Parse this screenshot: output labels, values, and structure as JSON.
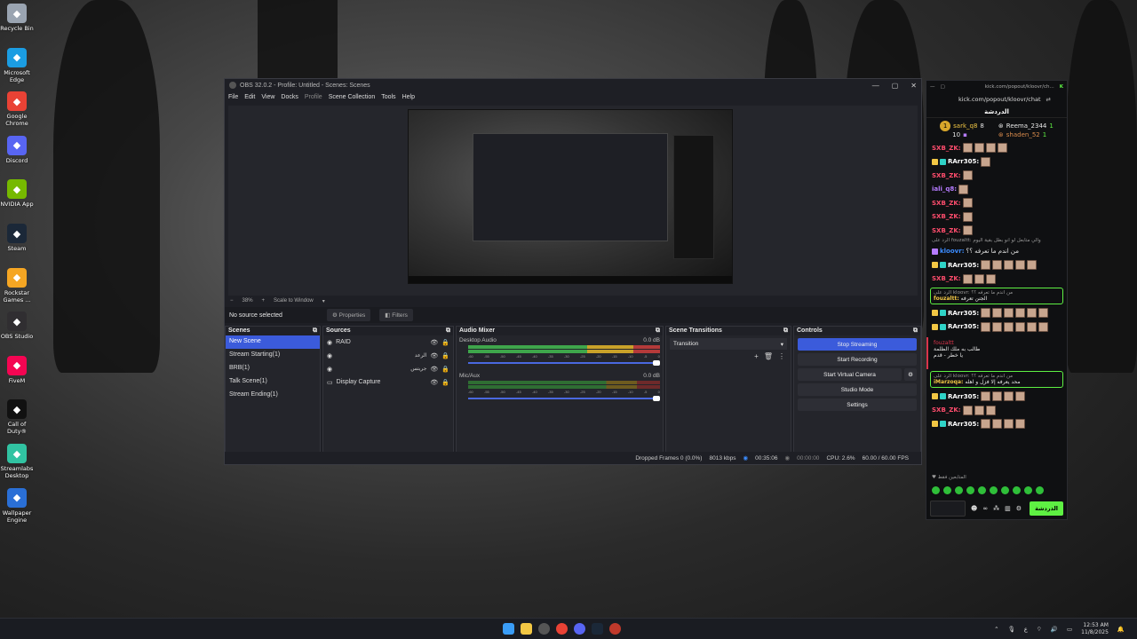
{
  "desktop": {
    "icons": [
      {
        "label": "Recycle Bin",
        "icon": "recycle-bin-icon",
        "color": "#9aa4b1"
      },
      {
        "label": "Microsoft Edge",
        "icon": "edge-icon",
        "color": "#1b9de2"
      },
      {
        "label": "Google Chrome",
        "icon": "chrome-icon",
        "color": "#e94235"
      },
      {
        "label": "Discord",
        "icon": "discord-icon",
        "color": "#5865f2"
      },
      {
        "label": "NVIDIA App",
        "icon": "nvidia-icon",
        "color": "#76b900"
      },
      {
        "label": "Steam",
        "icon": "steam-icon",
        "color": "#1b2838"
      },
      {
        "label": "Rockstar Games ...",
        "icon": "rockstar-icon",
        "color": "#f5a623"
      },
      {
        "label": "OBS Studio",
        "icon": "obs-icon",
        "color": "#302e31"
      },
      {
        "label": "FiveM",
        "icon": "fivem-icon",
        "color": "#f40552"
      },
      {
        "label": "Call of Duty®",
        "icon": "cod-icon",
        "color": "#111111"
      },
      {
        "label": "Streamlabs Desktop",
        "icon": "streamlabs-icon",
        "color": "#31c3a2"
      },
      {
        "label": "Wallpaper Engine",
        "icon": "wallpaper-engine-icon",
        "color": "#2a6fd6"
      }
    ]
  },
  "obs": {
    "title": "OBS 32.0.2 - Profile: Untitled - Scenes: Scenes",
    "menu": [
      "File",
      "Edit",
      "View",
      "Docks",
      "Profile",
      "Scene Collection",
      "Tools",
      "Help"
    ],
    "zoom": "38%",
    "scale_mode": "Scale to Window",
    "source_status": "No source selected",
    "properties_label": "Properties",
    "filters_label": "Filters",
    "scenes": {
      "title": "Scenes",
      "items": [
        "New Scene",
        "Stream Starting(1)",
        "BRB(1)",
        "Talk Scene(1)",
        "Stream Ending(1)"
      ]
    },
    "sources": {
      "title": "Sources",
      "items": [
        "RAID",
        "الرعد",
        "جريتس",
        "Display Capture"
      ]
    },
    "mixer": {
      "title": "Audio Mixer",
      "channels": [
        {
          "name": "Desktop Audio",
          "level": "0.0 dB"
        },
        {
          "name": "Mic/Aux",
          "level": "0.0 dB"
        }
      ],
      "ticks": [
        "-60",
        "-55",
        "-50",
        "-45",
        "-40",
        "-35",
        "-30",
        "-25",
        "-20",
        "-15",
        "-10",
        "-5",
        "0"
      ]
    },
    "transitions": {
      "title": "Scene Transitions",
      "selected": "Transition"
    },
    "controls": {
      "title": "Controls",
      "stop_streaming": "Stop Streaming",
      "start_recording": "Start Recording",
      "start_virtual_camera": "Start Virtual Camera",
      "studio_mode": "Studio Mode",
      "settings": "Settings"
    },
    "status": {
      "dropped": "Dropped Frames 0 (0.0%)",
      "bitrate": "8013 kbps",
      "stream_time": "00:35:06",
      "rec_time": "00:00:00",
      "cpu": "CPU: 2.6%",
      "fps": "60.00 / 60.00 FPS"
    },
    "accent": "#3b5bdb"
  },
  "chat": {
    "tab_title": "kick.com/popout/kloovr/ch...",
    "url": "kick.com/popout/kloovr/chat",
    "title": "الدردشة",
    "leaderboard": {
      "rank": "1",
      "left": [
        {
          "name": "sark_q8",
          "value": "8"
        },
        {
          "name": "",
          "value": "10"
        }
      ],
      "right": [
        {
          "name": "Reema_2344",
          "value": "1"
        },
        {
          "name": "shaden_52",
          "value": "1"
        }
      ]
    },
    "messages": [
      {
        "user": "SXB_ZK:",
        "color": "#ff4d6d",
        "emotes": 4
      },
      {
        "user": "RArr305:",
        "color": "#ffffff",
        "emotes": 1
      },
      {
        "user": "SXB_ZK:",
        "color": "#ff4d6d",
        "emotes": 1
      },
      {
        "user": "iali_q8:",
        "color": "#b67cff",
        "emotes": 1
      },
      {
        "user": "SXB_ZK:",
        "color": "#ff4d6d",
        "emotes": 1
      },
      {
        "user": "SXB_ZK:",
        "color": "#ff4d6d",
        "emotes": 1
      },
      {
        "user": "SXB_ZK:",
        "color": "#ff4d6d",
        "emotes": 1
      }
    ],
    "reply1_context": "الرد على fouzaltt: والي متابعل لو انو بطل بقية اليوم",
    "kloovr_msg": {
      "user": "kloovr:",
      "text": "من اندم ما تعرفه ؟؟"
    },
    "messages2": [
      {
        "user": "RArr305:",
        "color": "#ffffff",
        "emotes": 5
      },
      {
        "user": "SXB_ZK:",
        "color": "#ff4d6d",
        "emotes": 3
      }
    ],
    "reply2": {
      "context": "الرد على kloovr: من اندم ما تعرفه ؟؟",
      "user": "fouzaltt:",
      "text": "الجنن تعرفه"
    },
    "messages3": [
      {
        "user": "RArr305:",
        "color": "#ffffff",
        "emotes": 6
      },
      {
        "user": "RArr305:",
        "color": "#ffffff",
        "emotes": 6
      }
    ],
    "fouzaltt_card": {
      "user": "fouzaltt",
      "line1": "طالب به ملك الظلمة",
      "line2": "يا خطر - قدم"
    },
    "reply3": {
      "context": "الرد على kloovr: من اندم ما تعرفه ؟؟",
      "user": "iMarzoqa:",
      "text": "محد يعرفه إلا فزل و اهله"
    },
    "messages4": [
      {
        "user": "RArr305:",
        "color": "#ffffff",
        "emotes": 4
      },
      {
        "user": "SXB_ZK:",
        "color": "#ff4d6d",
        "emotes": 3
      },
      {
        "user": "RArr305:",
        "color": "#ffffff",
        "emotes": 4
      }
    ],
    "typing": "المتابعين فقط",
    "chat_button": "الدردشة",
    "accent": "#5ef043"
  },
  "taskbar": {
    "time": "12:53 AM",
    "date": "11/8/2025",
    "lang": "ع"
  }
}
